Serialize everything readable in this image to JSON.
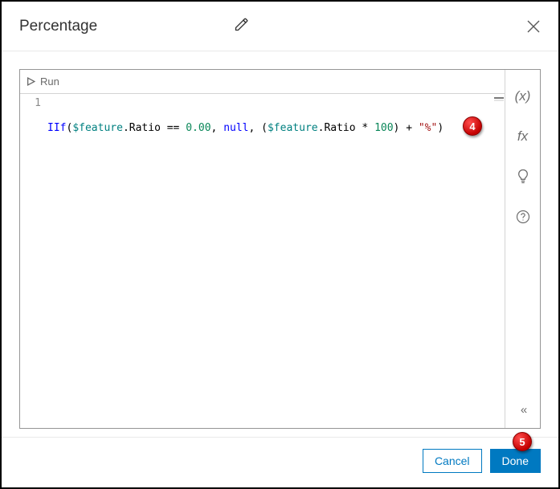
{
  "header": {
    "title": "Percentage"
  },
  "toolbar": {
    "run_label": "Run"
  },
  "editor": {
    "lines": [
      {
        "num": "1",
        "tokens": {
          "fn": "IIf",
          "p1": "(",
          "glob1": "$feature",
          "dot1": ".",
          "prop1": "Ratio",
          "sp1": " ",
          "eq": "==",
          "sp2": " ",
          "num1": "0.00",
          "c1": ",",
          "sp3": " ",
          "null": "null",
          "c2": ",",
          "sp4": " ",
          "p2": "(",
          "glob2": "$feature",
          "dot2": ".",
          "prop2": "Ratio",
          "sp5": " ",
          "mul": "*",
          "sp6": " ",
          "num2": "100",
          "p3": ")",
          "sp7": " ",
          "plus": "+",
          "sp8": " ",
          "str": "\"%\"",
          "p4": ")"
        }
      }
    ]
  },
  "side": {
    "globals": "(x)",
    "functions": "fx",
    "suggestions": "bulb",
    "help": "?",
    "collapse": "«"
  },
  "footer": {
    "cancel": "Cancel",
    "done": "Done"
  },
  "callouts": {
    "c4": "4",
    "c5": "5"
  }
}
